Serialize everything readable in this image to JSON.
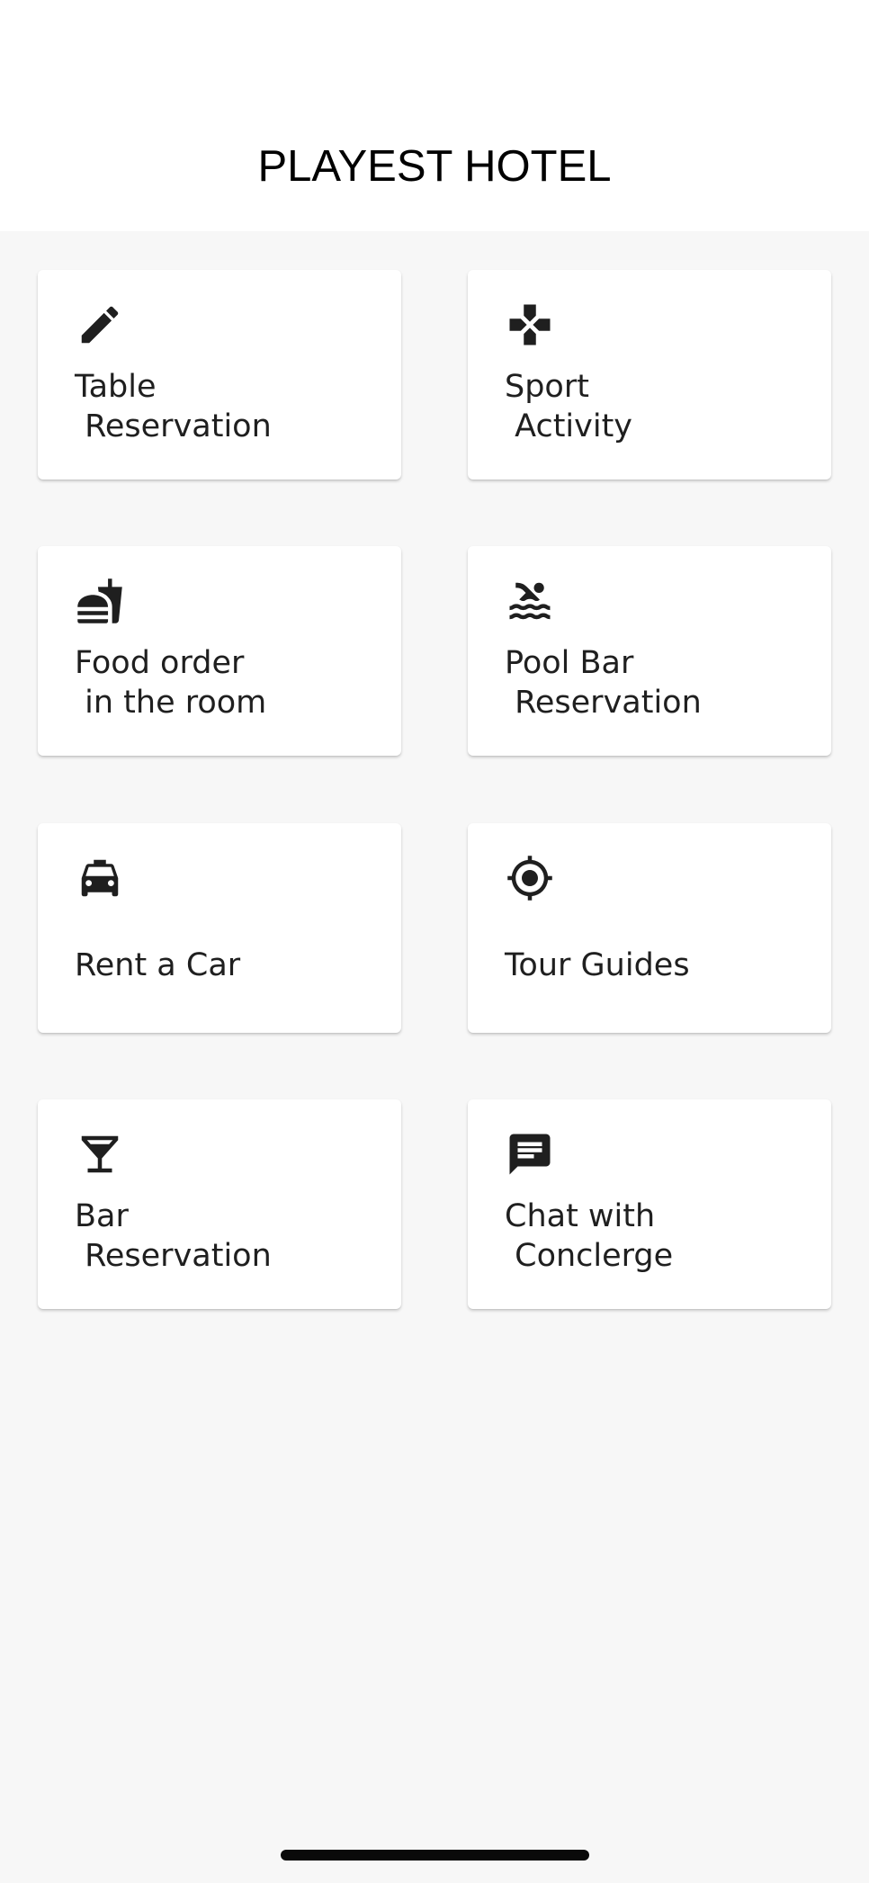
{
  "header": {
    "title": "PLAYEST HOTEL"
  },
  "services": [
    {
      "label": "Table\n Reservation",
      "icon": "pencil-icon"
    },
    {
      "label": "Sport\n Activity",
      "icon": "gamepad-icon"
    },
    {
      "label": "Food order\n in the room",
      "icon": "fastfood-icon"
    },
    {
      "label": "Pool Bar\n Reservation",
      "icon": "pool-icon"
    },
    {
      "label": "Rent a Car",
      "icon": "taxi-icon"
    },
    {
      "label": "Tour Guides",
      "icon": "target-icon"
    },
    {
      "label": "Bar\n Reservation",
      "icon": "cocktail-icon"
    },
    {
      "label": "Chat with\n Conclerge",
      "icon": "chat-icon"
    }
  ],
  "colors": {
    "background": "#f7f7f7",
    "card": "#ffffff",
    "icon": "#1f1f1f",
    "text": "#1f1f1f"
  }
}
